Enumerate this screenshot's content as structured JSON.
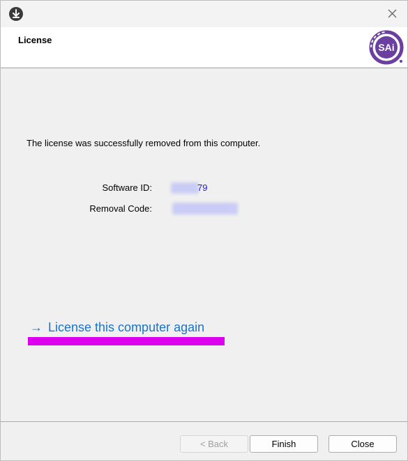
{
  "header": {
    "title": "License"
  },
  "logo": {
    "text": "SAi"
  },
  "message": "The license was successfully removed from this computer.",
  "fields": {
    "software_id_label": "Software ID:",
    "software_id_visible": "79",
    "removal_code_label": "Removal Code:"
  },
  "link": {
    "label": "License this computer again",
    "arrow": "→"
  },
  "buttons": {
    "back": "< Back",
    "finish": "Finish",
    "close": "Close"
  },
  "colors": {
    "link": "#1a73c9",
    "highlight": "#dd00ee",
    "logo": "#6b3fa0"
  }
}
